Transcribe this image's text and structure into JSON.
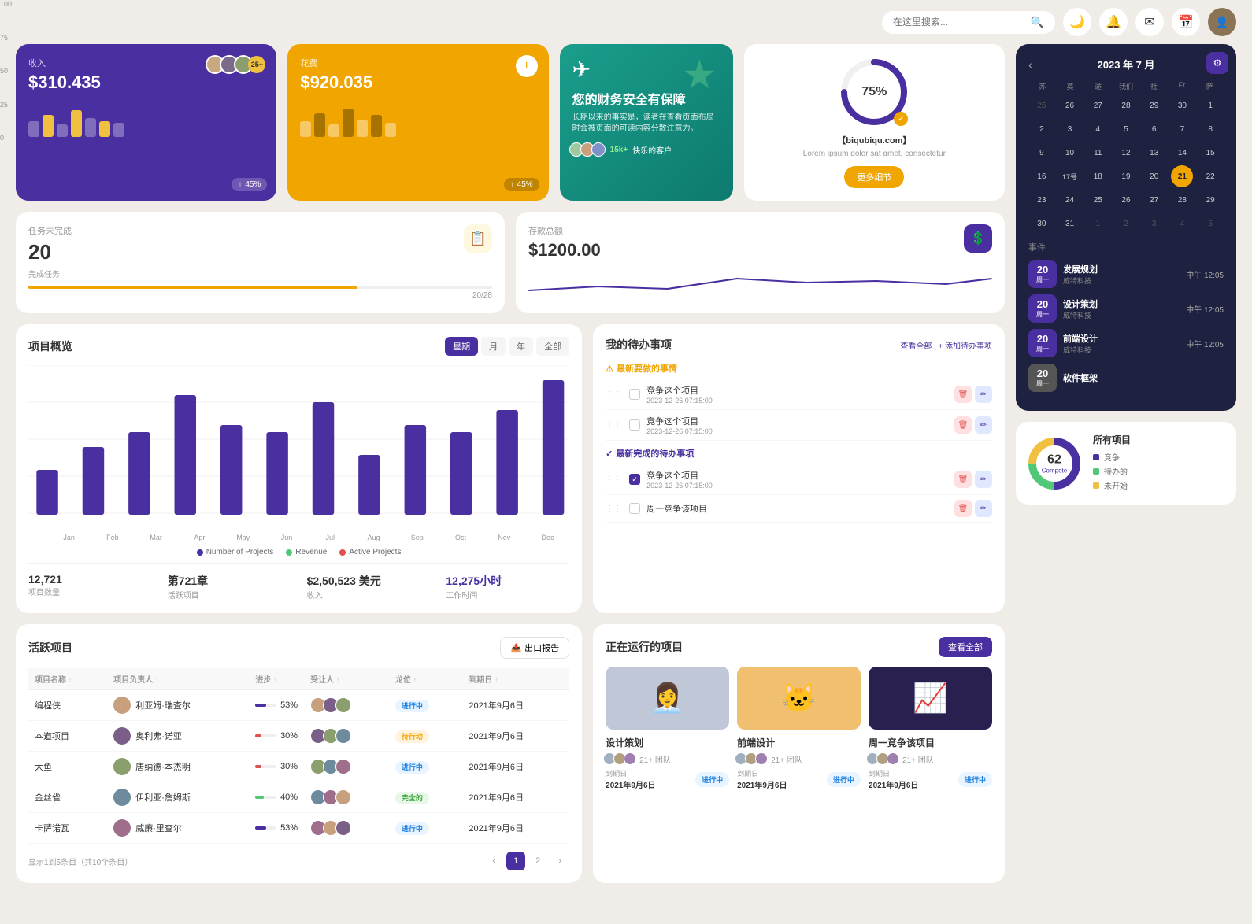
{
  "topbar": {
    "search_placeholder": "在这里搜索...",
    "moon_icon": "🌙",
    "bell_icon": "🔔",
    "mail_icon": "✉",
    "calendar_icon": "📅"
  },
  "revenue_card": {
    "label": "收入",
    "amount": "$310.435",
    "percent": "45%",
    "avatar_count": "25+"
  },
  "expense_card": {
    "label": "花费",
    "amount": "$920.035",
    "percent": "45%"
  },
  "promo_card": {
    "icon": "✈",
    "title": "您的财务安全有保障",
    "desc": "长期以来的事实是，读者在查看页面布局时会被页面的可读内容分散注意力。",
    "customer_count": "15k+",
    "customer_label": "快乐的客户"
  },
  "circle_card": {
    "percent": "75%",
    "title": "【biqubiqu.com】",
    "sub": "Lorem ipsum dolor sat amet, consectetur",
    "btn_label": "更多细节"
  },
  "task_card": {
    "label": "任务未完成",
    "num": "20",
    "sub": "完成任务",
    "progress_val": "71",
    "progress_text": "20/28"
  },
  "savings_card": {
    "label": "存款总额",
    "amount": "$1200.00"
  },
  "project_overview": {
    "title": "项目概览",
    "tabs": [
      "星期",
      "月",
      "年",
      "全部"
    ],
    "active_tab": 0,
    "months": [
      "Jan",
      "Feb",
      "Mar",
      "Apr",
      "May",
      "Jun",
      "Jul",
      "Aug",
      "Sep",
      "Oct",
      "Nov",
      "Dec"
    ],
    "bars": [
      30,
      45,
      55,
      80,
      60,
      55,
      75,
      40,
      60,
      55,
      70,
      90
    ],
    "legend": [
      {
        "label": "Number of Projects",
        "color": "#4a2fa0"
      },
      {
        "label": "Revenue",
        "color": "#50c878"
      },
      {
        "label": "Active Projects",
        "color": "#e05050"
      }
    ],
    "stats": [
      {
        "val": "12,721",
        "label": "项目数量"
      },
      {
        "val": "第721章",
        "label": "活跃项目"
      },
      {
        "val": "$2,50,523 美元",
        "label": "收入"
      },
      {
        "val": "12,275小时",
        "label": "工作时间",
        "purple": true
      }
    ]
  },
  "todo": {
    "title": "我的待办事项",
    "view_all": "查看全部",
    "add": "+ 添加待办事项",
    "urgent_label": "最新要做的事情",
    "done_label": "最新完成的待办事项",
    "items_urgent": [
      {
        "text": "竞争这个项目",
        "date": "2023-12-26 07:15:00"
      },
      {
        "text": "竞争这个项目",
        "date": "2023-12-26 07:15:00"
      }
    ],
    "items_done": [
      {
        "text": "竞争这个项目",
        "date": "2023-12-26 07:15:00"
      }
    ],
    "items_extra": [
      {
        "text": "周一竞争该项目"
      }
    ]
  },
  "active_projects": {
    "title": "活跃项目",
    "export_btn": "出口报告",
    "columns": [
      "项目名称",
      "项目负责人",
      "进步",
      "受让人",
      "龙位",
      "到期日"
    ],
    "rows": [
      {
        "name": "编程侠",
        "owner": "利亚姆·瑞查尔",
        "progress": 53,
        "progress_color": "#4a2fa0",
        "status": "进行中",
        "status_class": "status-active",
        "due": "2021年9月6日"
      },
      {
        "name": "本道项目",
        "owner": "奥利弗·诺亚",
        "progress": 30,
        "progress_color": "#e05050",
        "status": "待行动",
        "status_class": "status-pending",
        "due": "2021年9月6日"
      },
      {
        "name": "大鱼",
        "owner": "唐纳德·本杰明",
        "progress": 30,
        "progress_color": "#e05050",
        "status": "进行中",
        "status_class": "status-active",
        "due": "2021年9月6日"
      },
      {
        "name": "金丝雀",
        "owner": "伊利亚·詹姆斯",
        "progress": 40,
        "progress_color": "#50c878",
        "status": "完全的",
        "status_class": "status-complete",
        "due": "2021年9月6日"
      },
      {
        "name": "卡萨诺瓦",
        "owner": "威廉·里查尔",
        "progress": 53,
        "progress_color": "#4a2fa0",
        "status": "进行中",
        "status_class": "status-active",
        "due": "2021年9月6日"
      }
    ],
    "pagination_info": "显示1到5条目（共10个条目）",
    "current_page": 1,
    "total_pages": 2
  },
  "running_projects": {
    "title": "正在运行的项目",
    "view_all": "查看全部",
    "projects": [
      {
        "title": "设计策划",
        "team": "21+ 团队",
        "due_label": "到期日",
        "due": "2021年9月6日",
        "status": "进行中",
        "status_class": "status-active",
        "bg": "gray",
        "emoji": "👩‍💼"
      },
      {
        "title": "前端设计",
        "team": "21+ 团队",
        "due_label": "到期日",
        "due": "2021年9月6日",
        "status": "进行中",
        "status_class": "status-active",
        "bg": "orange",
        "emoji": "🐱"
      },
      {
        "title": "周一竞争该项目",
        "team": "21+ 团队",
        "due_label": "到期日",
        "due": "2021年9月6日",
        "status": "进行中",
        "status_class": "status-active",
        "bg": "dark",
        "emoji": "📊"
      }
    ]
  },
  "calendar": {
    "title": "2023 年 7 月",
    "days_header": [
      "苏",
      "莫",
      "途",
      "我们",
      "社",
      "Fr",
      "萨"
    ],
    "weeks": [
      [
        25,
        26,
        27,
        28,
        29,
        30,
        1
      ],
      [
        2,
        3,
        4,
        5,
        6,
        7,
        8
      ],
      [
        9,
        10,
        11,
        12,
        13,
        14,
        15
      ],
      [
        16,
        "17号",
        18,
        19,
        20,
        21,
        22
      ],
      [
        23,
        24,
        25,
        26,
        27,
        28,
        29
      ],
      [
        30,
        31,
        1,
        2,
        3,
        4,
        5
      ]
    ],
    "today": 21,
    "events_label": "事件",
    "events": [
      {
        "day": "20",
        "dow": "周一",
        "title": "发展规划",
        "sub": "威特科技",
        "time": "中午 12:05",
        "color": "#4a2fa0"
      },
      {
        "day": "20",
        "dow": "周一",
        "title": "设计策划",
        "sub": "威特科技",
        "time": "中午 12:05",
        "color": "#4a2fa0"
      },
      {
        "day": "20",
        "dow": "周一",
        "title": "前端设计",
        "sub": "威特科技",
        "time": "中午 12:05",
        "color": "#4a2fa0"
      },
      {
        "day": "20",
        "dow": "周一",
        "title": "软件框架",
        "sub": "",
        "time": "",
        "color": "#666"
      }
    ]
  },
  "all_projects": {
    "title": "所有项目",
    "total": "62",
    "total_sub": "Compete",
    "legend": [
      {
        "label": "竞争",
        "color": "#4a2fa0"
      },
      {
        "label": "待办的",
        "color": "#50c878"
      },
      {
        "label": "未开始",
        "color": "#f0c040"
      }
    ]
  }
}
